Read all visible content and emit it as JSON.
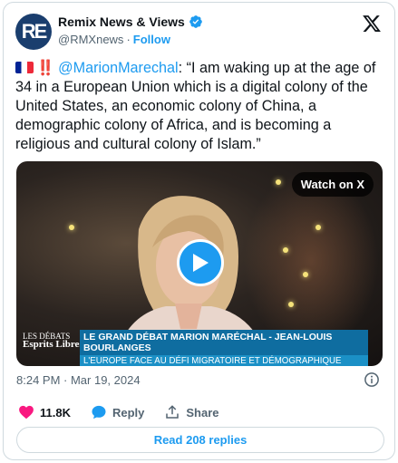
{
  "author": {
    "avatar_text": "RE",
    "display_name": "Remix News & Views",
    "handle": "@RMXnews",
    "separator": "·",
    "follow_label": "Follow"
  },
  "tweet": {
    "bangs": "‼️",
    "mention": "@MarionMarechal",
    "body": ": “I am waking up at the age of 34 in a European Union which is a digital colony of the United States, an economic colony of China, a demographic colony of Africa, and is becoming a religious and cultural colony of Islam.”"
  },
  "media": {
    "watch_label": "Watch on X",
    "logo_line1": "LES DÉBATS",
    "logo_line2": "Esprits Libres",
    "banner_title": "LE GRAND DÉBAT MARION MARÉCHAL - JEAN-LOUIS BOURLANGES",
    "banner_subtitle": "L'EUROPE FACE AU DÉFI MIGRATOIRE ET DÉMOGRAPHIQUE"
  },
  "meta": {
    "timestamp": "8:24 PM · Mar 19, 2024"
  },
  "actions": {
    "like_count": "11.8K",
    "reply_label": "Reply",
    "share_label": "Share"
  },
  "read_replies_label": "Read 208 replies",
  "colors": {
    "accent": "#1d9bf0",
    "like": "#f91880",
    "text": "#0f1419",
    "muted": "#536471"
  }
}
